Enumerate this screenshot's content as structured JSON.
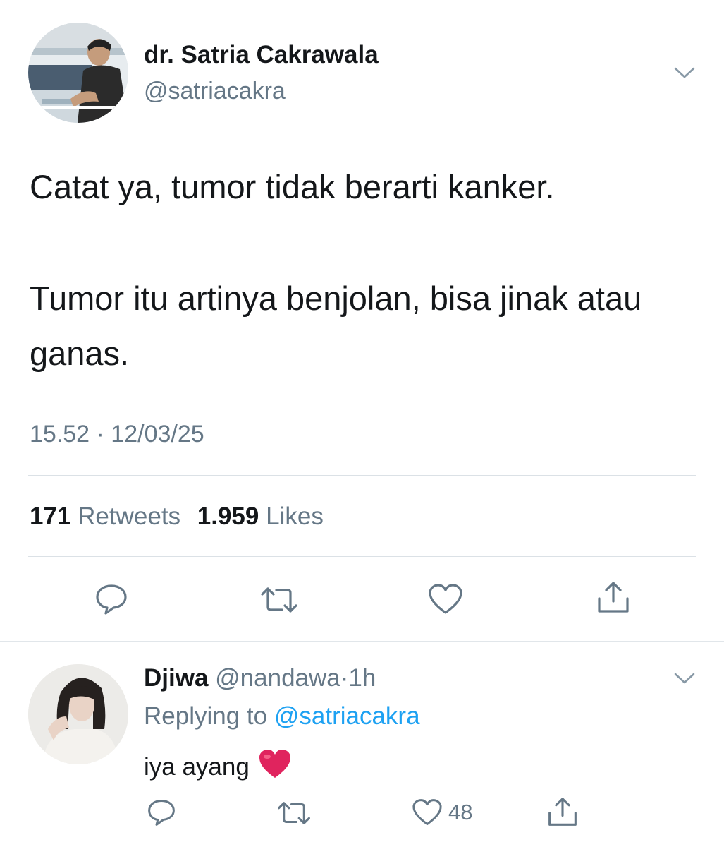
{
  "tweet": {
    "author_name": "dr. Satria Cakrawala",
    "author_handle": "@satriacakra",
    "text_line1": "Catat ya, tumor tidak berarti kanker.",
    "text_line2": "Tumor itu artinya benjolan, bisa jinak atau ganas.",
    "timestamp": "15.52 · 12/03/25",
    "retweet_count": "171",
    "retweet_label": "Retweets",
    "like_count": "1.959",
    "like_label": "Likes"
  },
  "reply": {
    "author_name": "Djiwa",
    "author_handle": "@nandawa",
    "separator": "·",
    "age": "1h",
    "replying_prefix": "Replying to",
    "replying_to": "@satriacakra",
    "text": "iya ayang",
    "like_count": "48"
  },
  "icons": {
    "reply": "reply-icon",
    "retweet": "retweet-icon",
    "like": "heart-icon",
    "share": "share-icon",
    "menu": "chevron-down-icon",
    "emoji": "red-heart-emoji"
  },
  "colors": {
    "text_primary": "#14171a",
    "text_secondary": "#657786",
    "icon": "#657786",
    "link": "#1da1f2",
    "divider": "#dbe1e6",
    "emoji_heart": "#e0245e"
  }
}
